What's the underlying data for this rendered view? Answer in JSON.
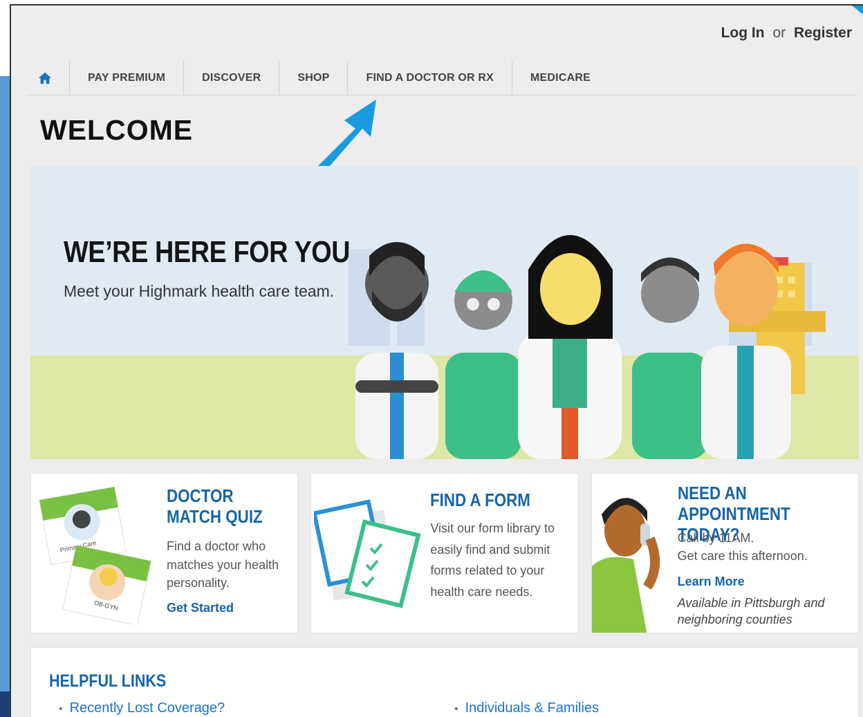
{
  "header": {
    "login_label": "Log In",
    "or_label": "or",
    "register_label": "Register"
  },
  "nav": {
    "items": [
      {
        "label": "PAY PREMIUM"
      },
      {
        "label": "DISCOVER"
      },
      {
        "label": "SHOP"
      },
      {
        "label": "FIND A DOCTOR OR RX"
      },
      {
        "label": "MEDICARE"
      }
    ]
  },
  "page_title": "WELCOME",
  "hero": {
    "title": "WE’RE HERE FOR YOU",
    "subtitle": "Meet your Highmark health care team."
  },
  "cards": [
    {
      "title_line1": "DOCTOR",
      "title_line2": "MATCH QUIZ",
      "text": "Find a doctor who matches your health personality.",
      "link": "Get Started",
      "tag1": "Primary Care",
      "tag2": "OB-GYN"
    },
    {
      "title": "FIND A FORM",
      "text": "Visit our form library to easily find and submit forms related to your health care needs."
    },
    {
      "title_line1": "NEED AN",
      "title_line2": "APPOINTMENT TODAY?",
      "text_line1": "Call by 11AM.",
      "text_line2": "Get care this afternoon.",
      "link": "Learn More",
      "note": "Available in Pittsburgh and neighboring counties"
    }
  ],
  "helpful_links": {
    "title": "HELPFUL LINKS",
    "items": [
      {
        "label": "Recently Lost Coverage?"
      },
      {
        "label": "Individuals & Families"
      }
    ]
  },
  "colors": {
    "accent_blue": "#1664a8",
    "link_blue": "#1a73c4",
    "arrow_blue": "#1a9be0"
  }
}
